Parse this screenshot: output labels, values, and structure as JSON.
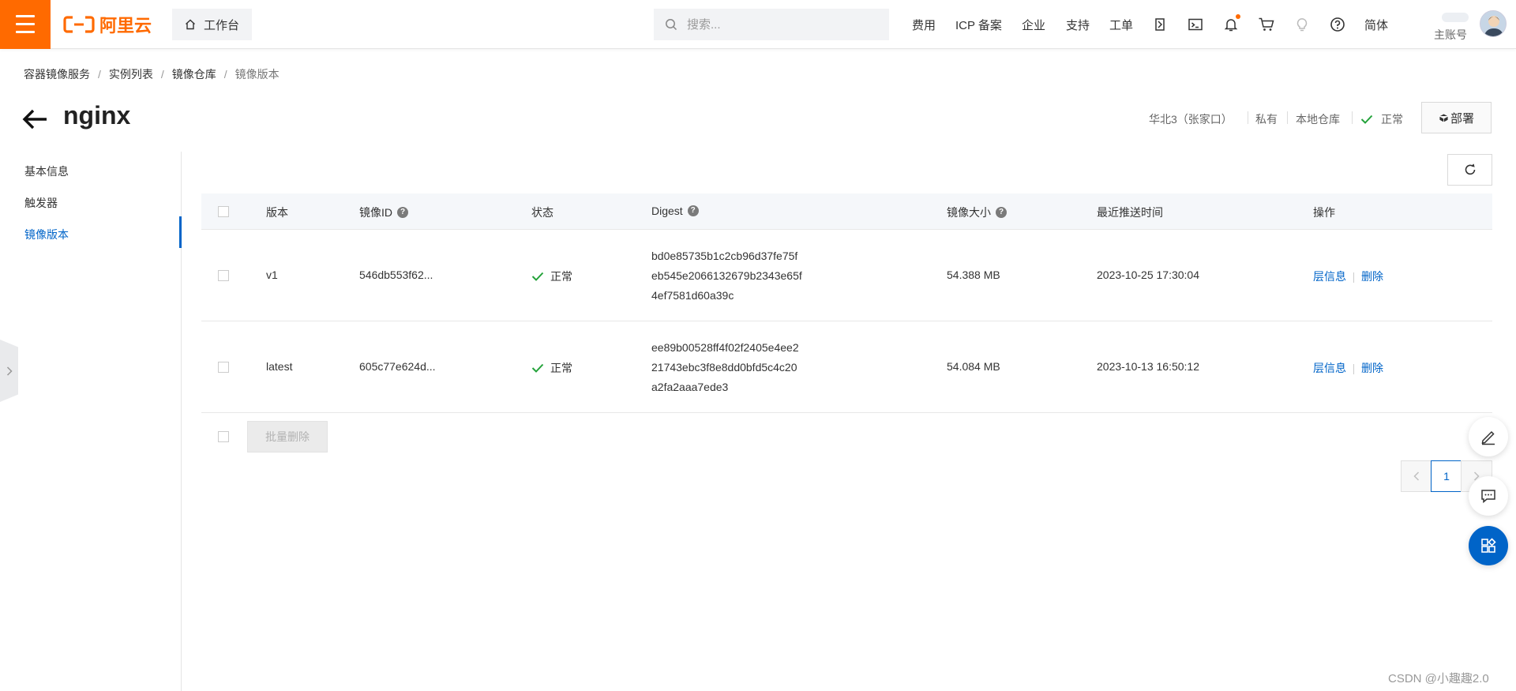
{
  "topbar": {
    "logo_text": "阿里云",
    "workbench_label": "工作台",
    "search_placeholder": "搜索...",
    "nav_links": [
      "费用",
      "ICP 备案",
      "企业",
      "支持",
      "工单"
    ],
    "lang_label": "简体",
    "account_label": "主账号",
    "icons": [
      "app-icon",
      "terminal-icon",
      "bell-icon",
      "cart-icon",
      "lightbulb-icon",
      "help-icon"
    ]
  },
  "breadcrumb": [
    "容器镜像服务",
    "实例列表",
    "镜像仓库",
    "镜像版本"
  ],
  "header": {
    "title": "nginx",
    "region": "华北3（张家口）",
    "visibility": "私有",
    "repo_type": "本地仓库",
    "status": "正常",
    "deploy_label": "部署"
  },
  "sidenav": {
    "items": [
      {
        "label": "基本信息",
        "active": false
      },
      {
        "label": "触发器",
        "active": false
      },
      {
        "label": "镜像版本",
        "active": true
      }
    ]
  },
  "table": {
    "columns": [
      "版本",
      "镜像ID",
      "状态",
      "Digest",
      "镜像大小",
      "最近推送时间",
      "操作"
    ],
    "rows": [
      {
        "version": "v1",
        "image_id": "546db553f62...",
        "status": "正常",
        "digest": [
          "bd0e85735b1c2cb96d37fe75f",
          "eb545e2066132679b2343e65f",
          "4ef7581d60a39c"
        ],
        "size": "54.388 MB",
        "pushed": "2023-10-25 17:30:04",
        "op_layers": "层信息",
        "op_delete": "删除"
      },
      {
        "version": "latest",
        "image_id": "605c77e624d...",
        "status": "正常",
        "digest": [
          "ee89b00528ff4f02f2405e4ee2",
          "21743ebc3f8e8dd0bfd5c4c20",
          "a2fa2aaa7ede3"
        ],
        "size": "54.084 MB",
        "pushed": "2023-10-13 16:50:12",
        "op_layers": "层信息",
        "op_delete": "删除"
      }
    ],
    "batch_delete_label": "批量删除"
  },
  "pagination": {
    "current": "1"
  },
  "colors": {
    "brand": "#ff6a00",
    "link": "#0064c8",
    "success": "#23a23a"
  },
  "watermark": "CSDN @小趣趣2.0"
}
